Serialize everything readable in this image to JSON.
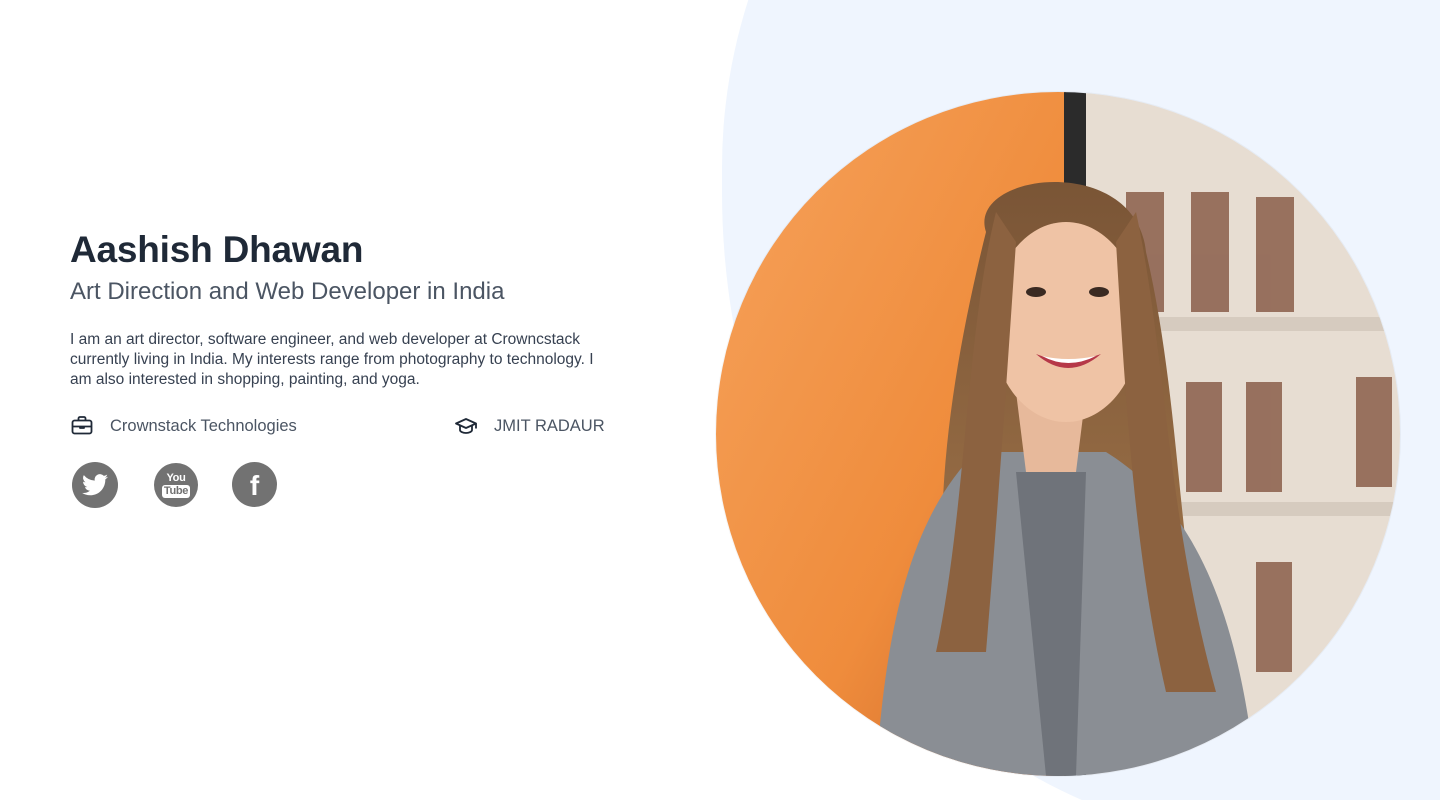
{
  "profile": {
    "name": "Aashish Dhawan",
    "subtitle": "Art Direction and Web Developer in India",
    "bio": "I am an art director, software engineer, and web developer at Crowncstack currently living in India. My interests range from photography to technology. I am also interested in shopping, painting, and yoga."
  },
  "meta": {
    "company": "Crownstack Technologies",
    "school": "JMIT RADAUR",
    "company_icon": "briefcase-icon",
    "school_icon": "graduation-cap-icon"
  },
  "social": [
    {
      "name": "Twitter",
      "icon": "twitter-icon"
    },
    {
      "name": "YouTube",
      "icon": "youtube-icon",
      "text_top": "You",
      "text_bottom": "Tube"
    },
    {
      "name": "Facebook",
      "icon": "facebook-icon",
      "text": "f"
    }
  ],
  "colors": {
    "heading": "#1f2937",
    "body": "#374151",
    "muted": "#4b5563",
    "social_bg": "#727272",
    "blob_bg": "#eff5fe",
    "portrait_orange": "#f39a4e"
  }
}
